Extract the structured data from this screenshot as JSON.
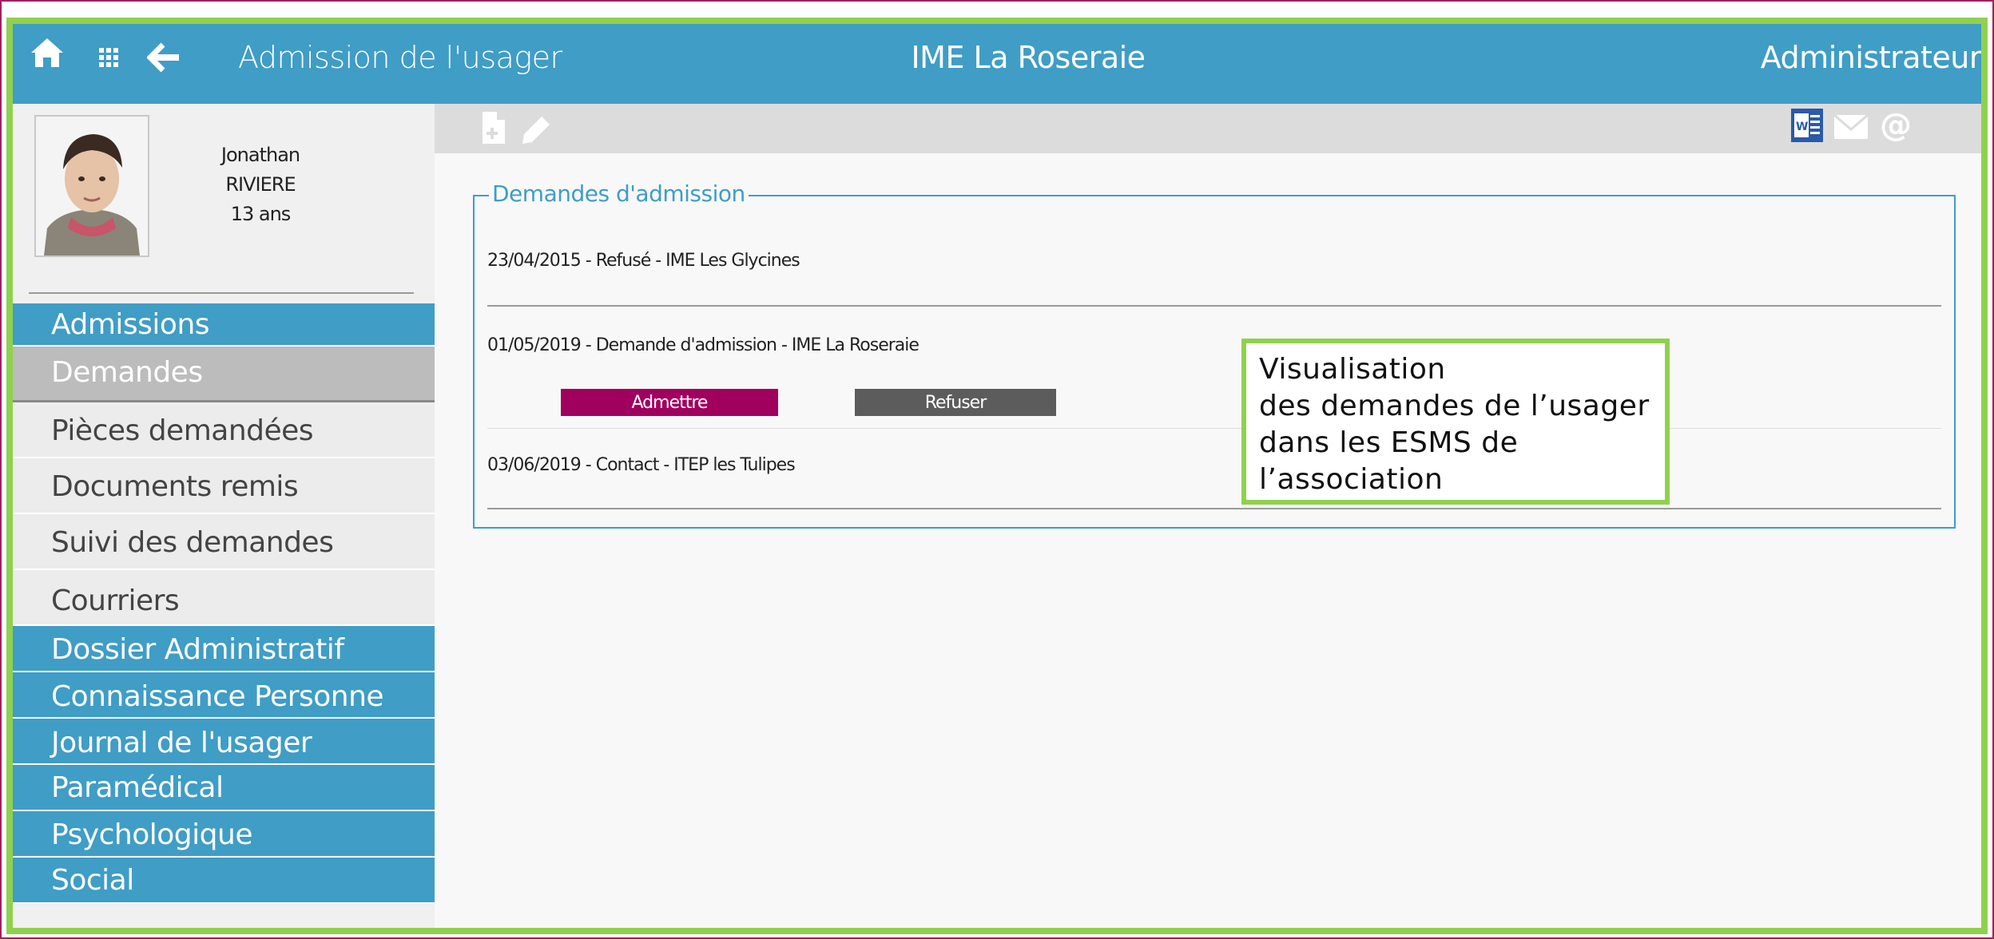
{
  "header": {
    "title": "Admission de l'usager",
    "establishment": "IME La Roseraie",
    "role": "Administrateur",
    "icons": [
      "home-icon",
      "apps-grid-icon",
      "back-arrow-icon"
    ],
    "background": "#3f9dc6"
  },
  "user": {
    "first_name": "Jonathan",
    "last_name": "RIVIERE",
    "age": "13 ans"
  },
  "menu": {
    "items": [
      {
        "label": "Admissions",
        "style": "section"
      },
      {
        "label": "Demandes",
        "style": "selected"
      },
      {
        "label": "Pièces demandées",
        "style": "sub"
      },
      {
        "label": "Documents remis",
        "style": "sub"
      },
      {
        "label": "Suivi des demandes",
        "style": "sub"
      },
      {
        "label": "Courriers",
        "style": "sub"
      },
      {
        "label": "Dossier Administratif",
        "style": "section"
      },
      {
        "label": "Connaissance Personne",
        "style": "section"
      },
      {
        "label": "Journal de l'usager",
        "style": "section"
      },
      {
        "label": "Paramédical",
        "style": "section"
      },
      {
        "label": "Psychologique",
        "style": "section"
      },
      {
        "label": "Social",
        "style": "section"
      }
    ]
  },
  "toolbar": {
    "icons_left": [
      "new-document-icon",
      "edit-pencil-icon"
    ],
    "icons_right": [
      "word-export-icon",
      "mail-icon",
      "at-email-icon"
    ]
  },
  "requests": {
    "legend": "Demandes d'admission",
    "rows": [
      {
        "text": "23/04/2015 - Refusé - IME Les Glycines"
      },
      {
        "text": "01/05/2019 - Demande d'admission - IME La Roseraie"
      },
      {
        "text": "03/06/2019 - Contact - ITEP les Tulipes"
      }
    ],
    "admit_label": "Admettre",
    "refuse_label": "Refuser",
    "admit_color": "#a0005e",
    "refuse_color": "#5c5c5c"
  },
  "callout": {
    "lines": [
      "Visualisation",
      "des demandes de l’usager",
      "dans les ESMS de",
      "l’association"
    ],
    "border_color": "#8fd14f"
  }
}
